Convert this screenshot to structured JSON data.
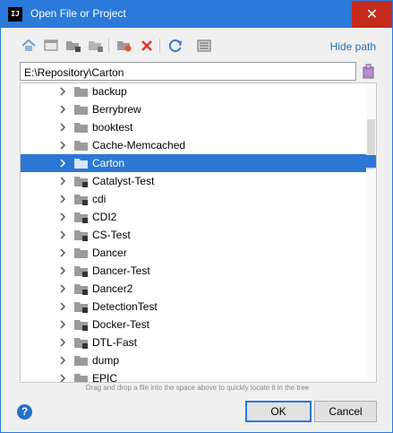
{
  "window": {
    "title": "Open File or Project",
    "app_icon_text": "IJ",
    "close_glyph": "✕"
  },
  "toolbar": {
    "buttons": [
      {
        "icon": "home-icon"
      },
      {
        "icon": "desktop-icon"
      },
      {
        "icon": "project-folder-icon"
      },
      {
        "icon": "module-folder-icon"
      },
      {
        "icon": "new-folder-icon"
      },
      {
        "icon": "delete-icon"
      },
      {
        "icon": "refresh-icon"
      },
      {
        "icon": "show-hidden-icon"
      }
    ],
    "hide_path_label": "Hide path"
  },
  "path": {
    "value": "E:\\Repository\\Carton"
  },
  "tree": {
    "items": [
      {
        "label": "backup",
        "has_badge": false,
        "selected": false
      },
      {
        "label": "Berrybrew",
        "has_badge": false,
        "selected": false
      },
      {
        "label": "booktest",
        "has_badge": false,
        "selected": false
      },
      {
        "label": "Cache-Memcached",
        "has_badge": false,
        "selected": false
      },
      {
        "label": "Carton",
        "has_badge": false,
        "selected": true
      },
      {
        "label": "Catalyst-Test",
        "has_badge": true,
        "selected": false
      },
      {
        "label": "cdi",
        "has_badge": true,
        "selected": false
      },
      {
        "label": "CDI2",
        "has_badge": true,
        "selected": false
      },
      {
        "label": "CS-Test",
        "has_badge": true,
        "selected": false
      },
      {
        "label": "Dancer",
        "has_badge": false,
        "selected": false
      },
      {
        "label": "Dancer-Test",
        "has_badge": true,
        "selected": false
      },
      {
        "label": "Dancer2",
        "has_badge": true,
        "selected": false
      },
      {
        "label": "DetectionTest",
        "has_badge": true,
        "selected": false
      },
      {
        "label": "Docker-Test",
        "has_badge": true,
        "selected": false
      },
      {
        "label": "DTL-Fast",
        "has_badge": true,
        "selected": false
      },
      {
        "label": "dump",
        "has_badge": false,
        "selected": false
      },
      {
        "label": "EPIC",
        "has_badge": false,
        "selected": false
      }
    ]
  },
  "hint": "Drag and drop a file into the space above to quickly locate it in the tree",
  "footer": {
    "help_glyph": "?",
    "ok_label": "OK",
    "cancel_label": "Cancel"
  },
  "colors": {
    "title_bar": "#2b79d8",
    "close_button": "#c42b1c",
    "selection": "#2c77d6",
    "link": "#2470b3"
  }
}
